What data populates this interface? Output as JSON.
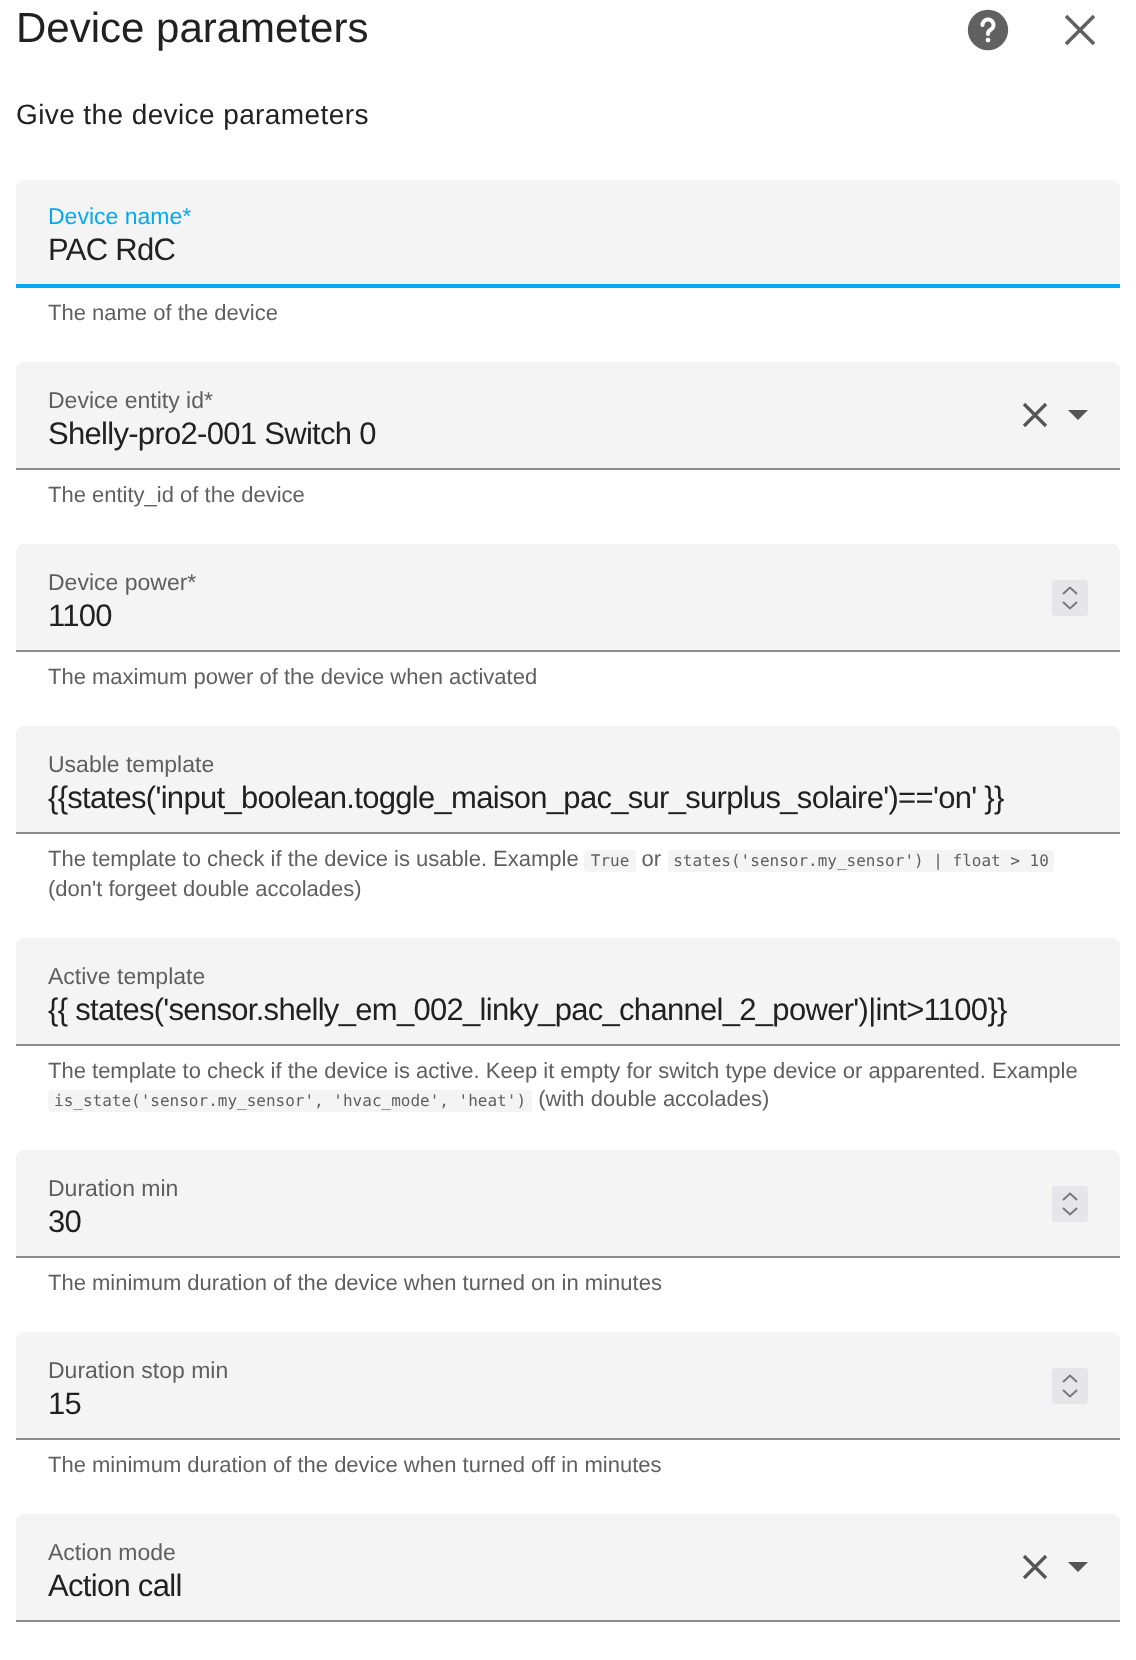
{
  "dialog": {
    "title": "Device parameters",
    "subtitle": "Give the device parameters"
  },
  "fields": [
    {
      "kind": "text",
      "label": "Device name*",
      "value": "PAC RdC",
      "focused": true,
      "helper": [
        {
          "kind": "text",
          "text": "The name of the device"
        }
      ]
    },
    {
      "kind": "select",
      "label": "Device entity id*",
      "value": "Shelly-pro2-001 Switch 0",
      "focused": false,
      "helper": [
        {
          "kind": "text",
          "text": "The entity_id of the device"
        }
      ]
    },
    {
      "kind": "number",
      "label": "Device power*",
      "value": "1100",
      "focused": false,
      "helper": [
        {
          "kind": "text",
          "text": "The maximum power of the device when activated"
        }
      ]
    },
    {
      "kind": "text",
      "label": "Usable template",
      "value": "{{states('input_boolean.toggle_maison_pac_sur_surplus_solaire')=='on' }}",
      "focused": false,
      "helper": [
        {
          "kind": "text",
          "text": "The template to check if the device is usable. Example "
        },
        {
          "kind": "code",
          "text": "True"
        },
        {
          "kind": "text",
          "text": " or "
        },
        {
          "kind": "code",
          "text": "states('sensor.my_sensor') | float > 10"
        },
        {
          "kind": "text",
          "text": " (don't forgeet double accolades)"
        }
      ]
    },
    {
      "kind": "text",
      "label": "Active template",
      "value": "{{ states('sensor.shelly_em_002_linky_pac_channel_2_power')|int>1100}}",
      "focused": false,
      "helper": [
        {
          "kind": "text",
          "text": "The template to check if the device is active. Keep it empty for switch type device or apparented. Example "
        },
        {
          "kind": "code",
          "text": "is_state('sensor.my_sensor', 'hvac_mode', 'heat')"
        },
        {
          "kind": "text",
          "text": " (with double accolades)"
        }
      ]
    },
    {
      "kind": "number",
      "label": "Duration min",
      "value": "30",
      "focused": false,
      "helper": [
        {
          "kind": "text",
          "text": "The minimum duration of the device when turned on in minutes"
        }
      ]
    },
    {
      "kind": "number",
      "label": "Duration stop min",
      "value": "15",
      "focused": false,
      "helper": [
        {
          "kind": "text",
          "text": "The minimum duration of the device when turned off in minutes"
        }
      ]
    },
    {
      "kind": "select",
      "label": "Action mode",
      "value": "Action call",
      "focused": false
    }
  ]
}
